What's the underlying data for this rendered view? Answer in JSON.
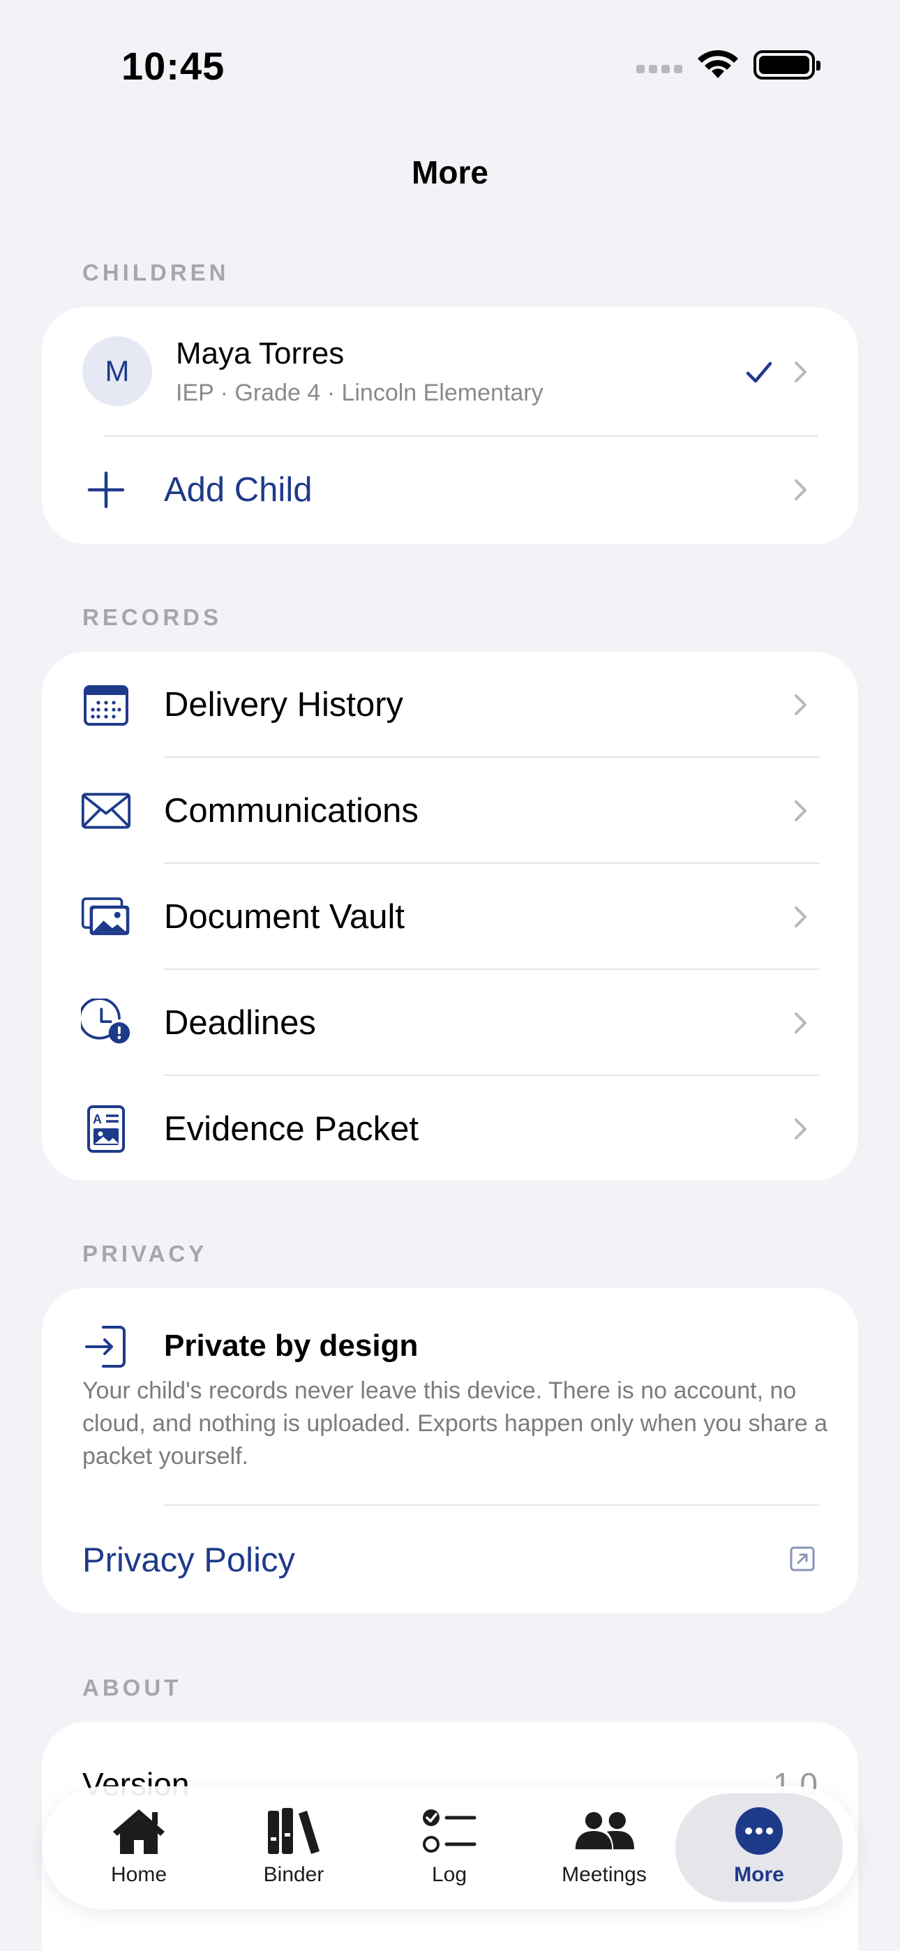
{
  "status": {
    "time": "10:45"
  },
  "nav": {
    "title": "More"
  },
  "children": {
    "header": "CHILDREN",
    "child": {
      "initial": "M",
      "name": "Maya Torres",
      "details": "IEP · Grade 4 · Lincoln Elementary"
    },
    "add_label": "Add Child"
  },
  "records": {
    "header": "RECORDS",
    "items": [
      {
        "label": "Delivery History",
        "icon": "calendar-icon"
      },
      {
        "label": "Communications",
        "icon": "envelope-icon"
      },
      {
        "label": "Document Vault",
        "icon": "photos-icon"
      },
      {
        "label": "Deadlines",
        "icon": "clock-alert-icon"
      },
      {
        "label": "Evidence Packet",
        "icon": "packet-icon"
      }
    ]
  },
  "privacy": {
    "header": "PRIVACY",
    "title": "Private by design",
    "body": "Your child's records never leave this device. There is no account, no cloud, and nothing is uploaded. Exports happen only when you share a packet yourself.",
    "link": "Privacy Policy"
  },
  "about": {
    "header": "ABOUT",
    "version_label": "Version",
    "version_value": "1.0"
  },
  "tabs": [
    {
      "label": "Home",
      "icon": "house-icon"
    },
    {
      "label": "Binder",
      "icon": "books-icon"
    },
    {
      "label": "Log",
      "icon": "checklist-icon"
    },
    {
      "label": "Meetings",
      "icon": "people-icon"
    },
    {
      "label": "More",
      "icon": "ellipsis-icon",
      "active": true
    }
  ],
  "colors": {
    "accent": "#1e3a8a",
    "background": "#f2f2f7"
  }
}
